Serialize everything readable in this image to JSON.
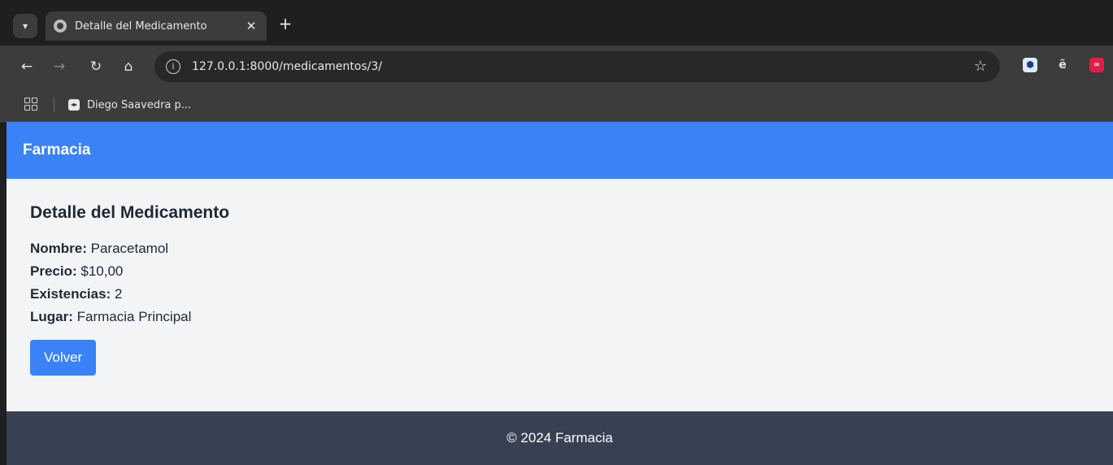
{
  "browser": {
    "tab_title": "Detalle del Medicamento",
    "tab_close": "✕",
    "new_tab": "+",
    "url": "127.0.0.1:8000/medicamentos/3/",
    "bookmark_label": "Diego Saavedra p...",
    "icons": [
      "tab-search-icon",
      "globe-icon",
      "back-arrow-icon",
      "forward-arrow-icon",
      "reload-icon",
      "home-icon",
      "site-info-icon",
      "star-icon",
      "apps-icon"
    ]
  },
  "site": {
    "brand": "Farmacia",
    "accent_color": "#3b82f6",
    "footer_color": "#374151",
    "footer_text": "© 2024 Farmacia"
  },
  "detail": {
    "title": "Detalle del Medicamento",
    "fields": [
      {
        "label": "Nombre:",
        "value": "Paracetamol"
      },
      {
        "label": "Precio:",
        "value": "$10,00"
      },
      {
        "label": "Existencias:",
        "value": "2"
      },
      {
        "label": "Lugar:",
        "value": "Farmacia Principal"
      }
    ],
    "back_button": "Volver"
  }
}
